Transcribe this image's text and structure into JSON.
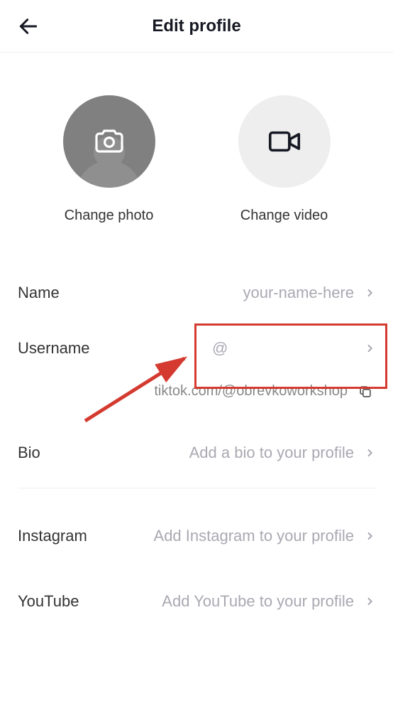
{
  "header": {
    "title": "Edit profile"
  },
  "media": {
    "photo_label": "Change photo",
    "video_label": "Change video"
  },
  "rows": {
    "name": {
      "label": "Name",
      "value": "your-name-here"
    },
    "username": {
      "label": "Username",
      "value": "@"
    },
    "bio": {
      "label": "Bio",
      "value": "Add a bio to your profile"
    },
    "instagram": {
      "label": "Instagram",
      "value": "Add Instagram to your profile"
    },
    "youtube": {
      "label": "YouTube",
      "value": "Add YouTube to your profile"
    }
  },
  "profile_link": "tiktok.com/@obrevkoworkshop",
  "annotation": {
    "highlight_target": "username-row"
  }
}
